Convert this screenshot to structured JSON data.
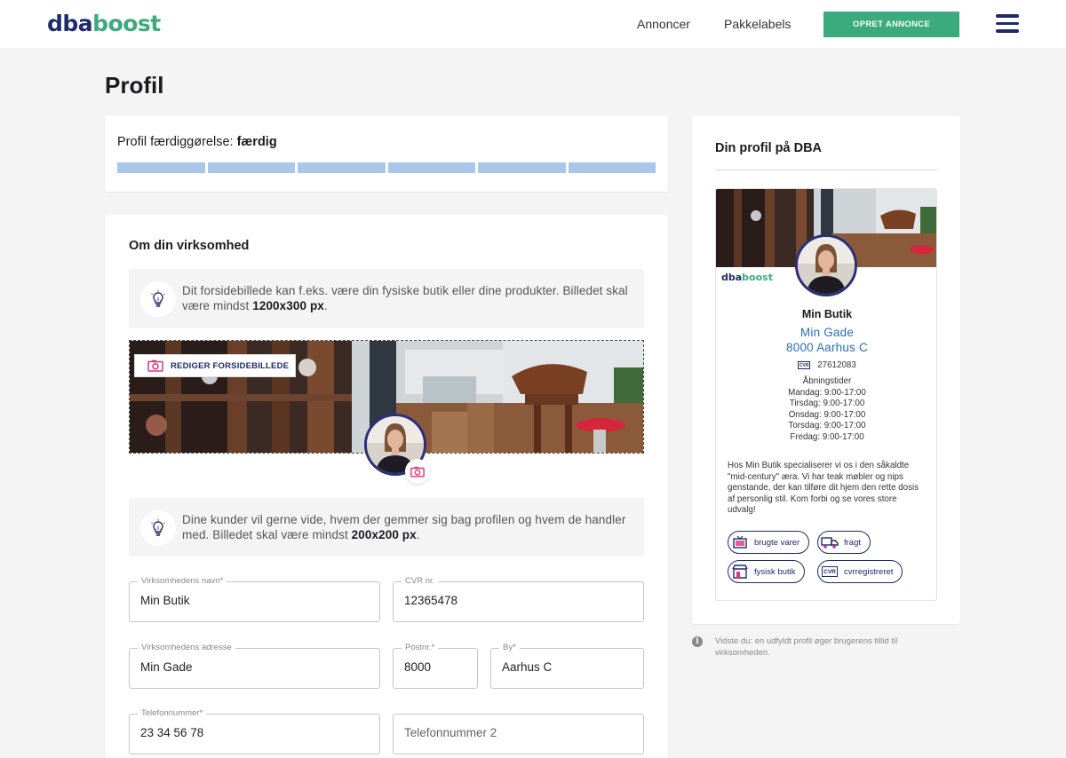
{
  "header": {
    "logo_part1": "dba",
    "logo_part2": "boost",
    "nav": [
      "Annoncer",
      "Pakkelabels"
    ],
    "cta_label": "OPRET ANNONCE",
    "menu_icon": "hamburger-icon"
  },
  "page": {
    "title": "Profil"
  },
  "completion": {
    "label": "Profil færdiggørelse:",
    "status": "færdig",
    "segments_filled": 6,
    "segments_total": 6
  },
  "business": {
    "title": "Om din virksomhed",
    "tip1": {
      "text": "Dit forsidebillede kan f.eks. være din fysiske butik eller dine produkter. Billedet skal være mindst ",
      "bold": "1200x300 px",
      "end": "."
    },
    "edit_cover_label": "REDIGER FORSIDEBILLEDE",
    "tip2": {
      "text": "Dine kunder vil gerne vide, hvem der gemmer sig bag profilen og hvem de handler med. Billedet skal være mindst ",
      "bold": "200x200 px",
      "end": "."
    },
    "fields": {
      "name": {
        "label": "Virksomhedens navn*",
        "value": "Min Butik"
      },
      "cvr": {
        "label": "CVR nr.",
        "value": "12365478"
      },
      "address": {
        "label": "Virksomhedens adresse",
        "value": "Min Gade"
      },
      "postal": {
        "label": "Postnr.*",
        "value": "8000"
      },
      "city": {
        "label": "By*",
        "value": "Aarhus C"
      },
      "phone": {
        "label": "Telefonnummer*",
        "value": "23 34 56 78"
      },
      "phone2": {
        "placeholder": "Telefonnummer 2"
      }
    }
  },
  "preview": {
    "title": "Din profil på DBA",
    "logo_part1": "dba",
    "logo_part2": "boost",
    "name": "Min Butik",
    "street": "Min Gade",
    "city": "8000 Aarhus C",
    "cvr_badge": "CVR",
    "cvr": "27612083",
    "hours_title": "Åbningstider",
    "hours": [
      "Mandag: 9:00-17:00",
      "Tirsdag: 9:00-17:00",
      "Onsdag: 9:00-17:00",
      "Torsdag: 9:00-17:00",
      "Fredag: 9:00-17:00"
    ],
    "description": "Hos Min Butik specialiserer vi os i den såkaldte \"mid-century\" æra. Vi har teak møbler og nips genstande, der kan tilføre dit hjem den rette dosis af personlig stil. Kom forbi og se vores store udvalg!",
    "tags": [
      "brugte varer",
      "fragt",
      "fysisk butik",
      "cvrregistreret"
    ]
  },
  "info_note": "Vidste du: en udfyldt profil øger brugerens tillid til virksomheden.",
  "colors": {
    "brand_navy": "#1f2a6b",
    "brand_green": "#3bab7e",
    "progress": "#a8c7ea",
    "link_blue": "#2a6ebb"
  }
}
